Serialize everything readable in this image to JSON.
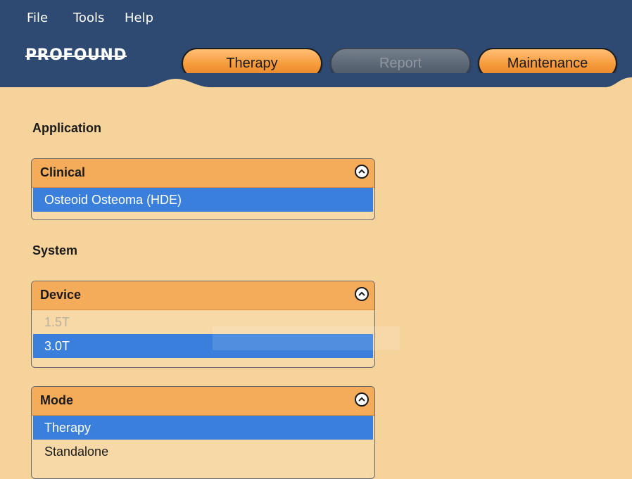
{
  "menu": {
    "file": "File",
    "tools": "Tools",
    "help": "Help"
  },
  "brand": "PROFOUND",
  "tabs": {
    "therapy": "Therapy",
    "report": "Report",
    "maintenance": "Maintenance"
  },
  "application": {
    "label": "Application",
    "list_title": "Clinical",
    "items": [
      "Osteoid Osteoma (HDE)"
    ]
  },
  "system": {
    "label": "System",
    "device": {
      "title": "Device",
      "items": [
        "1.5T",
        "3.0T"
      ]
    },
    "mode": {
      "title": "Mode",
      "items": [
        "Therapy",
        "Standalone"
      ]
    }
  }
}
